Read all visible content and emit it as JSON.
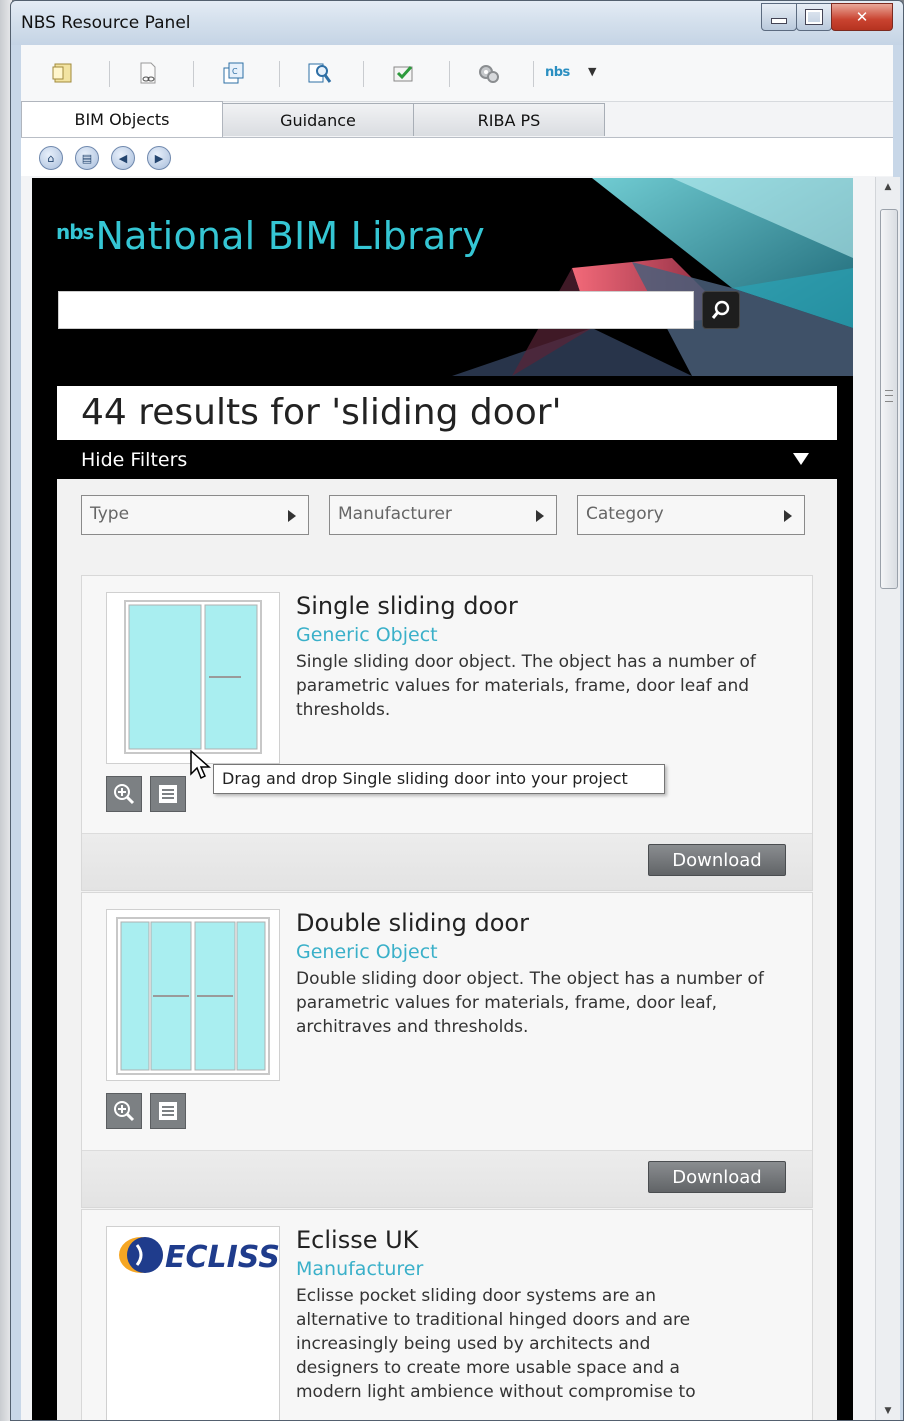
{
  "window": {
    "title": "NBS Resource Panel",
    "close_glyph": "✕"
  },
  "toolbar": {
    "icons": [
      "new-document-icon",
      "link-document-icon",
      "copy-clause-icon",
      "search-document-icon",
      "check-list-icon",
      "settings-gears-icon",
      "nbs-logo-icon"
    ],
    "nbs_label": "nbs",
    "dropdown_caret": "▼"
  },
  "tabs": [
    {
      "label": "BIM Objects",
      "active": true
    },
    {
      "label": "Guidance",
      "active": false
    },
    {
      "label": "RIBA PS",
      "active": false
    }
  ],
  "nav_icons": [
    "home-icon",
    "report-icon",
    "back-icon",
    "forward-icon"
  ],
  "library": {
    "brand_prefix": "nbs",
    "brand_name": "National BIM Library",
    "search_value": "",
    "search_icon": "magnifier-icon"
  },
  "results": {
    "heading": "44 results for 'sliding door'",
    "hide_filters_label": "Hide Filters",
    "filters": [
      {
        "label": "Type"
      },
      {
        "label": "Manufacturer"
      },
      {
        "label": "Category"
      }
    ]
  },
  "items": [
    {
      "title": "Single sliding door",
      "subtitle": "Generic Object",
      "description": "Single sliding door object. The object has a number of parametric values for materials, frame, door leaf and thresholds.",
      "download_label": "Download"
    },
    {
      "title": "Double sliding door",
      "subtitle": "Generic Object",
      "description": "Double sliding door object. The object has a number of parametric values for materials, frame, door leaf, architraves and thresholds.",
      "download_label": "Download"
    },
    {
      "title": "Eclisse UK",
      "subtitle": "Manufacturer",
      "description": "Eclisse pocket sliding door systems are an alternative to traditional hinged doors and are increasingly being used by architects and designers to create more usable space and a modern light ambience without compromise to",
      "logo_text": "ECLISSE"
    }
  ],
  "tooltip": {
    "text": "Drag and drop Single sliding door into your project"
  },
  "colors": {
    "accent_teal": "#35c6d4",
    "subtitle_blue": "#3ab0c9",
    "door_glass": "#a9eef0"
  }
}
